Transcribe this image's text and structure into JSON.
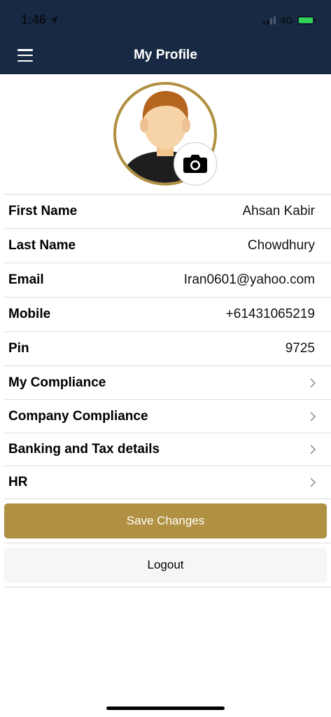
{
  "status_bar": {
    "time": "1:46",
    "network": "4G"
  },
  "header": {
    "title": "My Profile"
  },
  "profile_fields": [
    {
      "label": "First Name",
      "value": "Ahsan Kabir"
    },
    {
      "label": "Last Name",
      "value": "Chowdhury"
    },
    {
      "label": "Email",
      "value": "Iran0601@yahoo.com"
    },
    {
      "label": "Mobile",
      "value": "+61431065219"
    },
    {
      "label": "Pin",
      "value": "9725"
    }
  ],
  "nav_items": [
    {
      "label": "My Compliance"
    },
    {
      "label": "Company Compliance"
    },
    {
      "label": "Banking and Tax details"
    },
    {
      "label": "HR"
    }
  ],
  "actions": {
    "save_label": "Save Changes",
    "logout_label": "Logout"
  },
  "colors": {
    "header_bg": "#182a43",
    "accent": "#b09042",
    "avatar_ring": "#b09040"
  }
}
